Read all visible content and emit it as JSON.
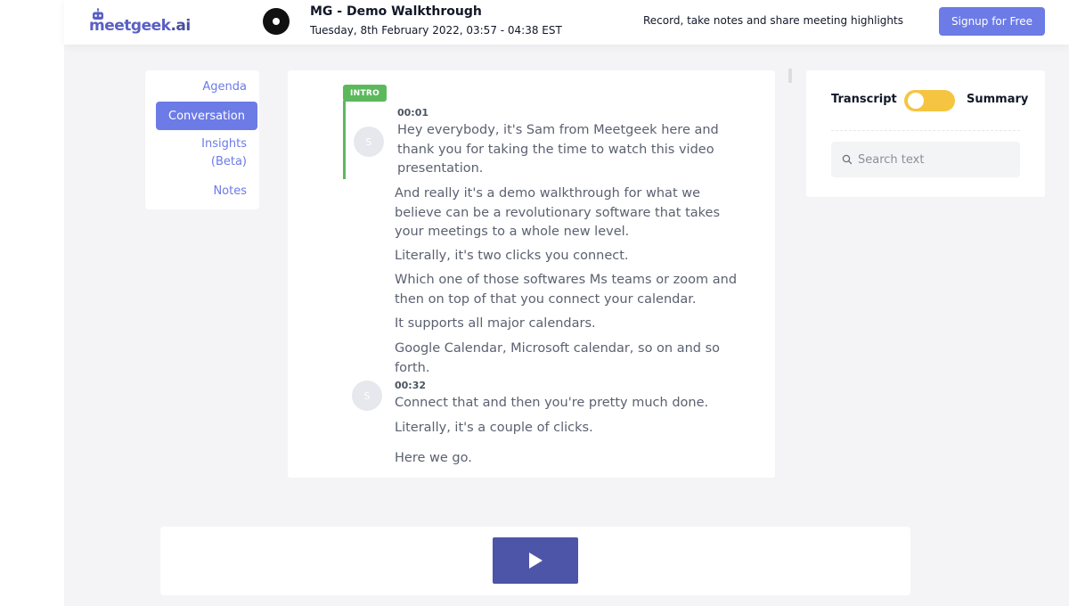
{
  "header": {
    "logo_text": "meetgeek",
    "logo_suffix": ".ai",
    "meeting_title": "MG - Demo Walkthrough",
    "meeting_date": "Tuesday, 8th February 2022, 03:57 - 04:38 EST",
    "tagline": "Record, take notes and share meeting highlights",
    "signup_label": "Signup for Free"
  },
  "nav": {
    "agenda": "Agenda",
    "conversation": "Conversation",
    "insights_line1": "Insights",
    "insights_line2": "(Beta)",
    "notes": "Notes"
  },
  "transcript": {
    "section_badge": "INTRO",
    "blocks": [
      {
        "avatar": "S",
        "time": "00:01",
        "paragraphs": [
          [
            "Hey everybody, it's Sam from Meetgeek here and",
            "thank you for taking the time to watch this video",
            "presentation."
          ],
          [
            "And really it's a demo walkthrough for what we",
            "believe can be a revolutionary software that takes",
            "your meetings to a whole new level."
          ],
          [
            "Literally, it's two clicks you connect."
          ],
          [
            "Which one of those softwares Ms teams or zoom and",
            "then on top of that you connect your calendar."
          ],
          [
            "It supports all major calendars."
          ],
          [
            "Google Calendar, Microsoft calendar, so on and so",
            "forth."
          ]
        ]
      },
      {
        "avatar": "S",
        "time": "00:32",
        "paragraphs": [
          [
            "Connect that and then you're pretty much done."
          ],
          [
            "Literally, it's a couple of clicks."
          ],
          [
            "Here we go."
          ]
        ]
      }
    ]
  },
  "right_panel": {
    "transcript_label": "Transcript",
    "summary_label": "Summary",
    "toggle_state": "transcript",
    "search_placeholder": "Search text"
  },
  "player": {
    "play_icon": "play-icon"
  },
  "colors": {
    "accent": "#6c7be6",
    "intro_green": "#5cb85c",
    "toggle_yellow": "#f5c542",
    "play_button": "#4d55a8"
  }
}
